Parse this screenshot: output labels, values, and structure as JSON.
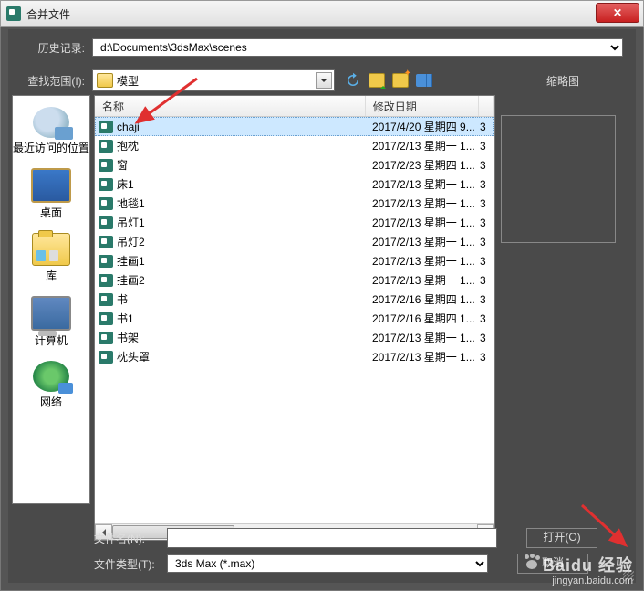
{
  "window": {
    "title": "合并文件"
  },
  "labels": {
    "history": "历史记录:",
    "scope": "查找范围(I):",
    "thumbnail": "缩略图",
    "filename": "文件名(N):",
    "filetype": "文件类型(T):"
  },
  "history_path": "d:\\Documents\\3dsMax\\scenes",
  "scope_folder": "模型",
  "columns": {
    "name": "名称",
    "date": "修改日期"
  },
  "files": [
    {
      "name": "chaji",
      "date": "2017/4/20 星期四 9...",
      "sel": true
    },
    {
      "name": "抱枕",
      "date": "2017/2/13 星期一 1..."
    },
    {
      "name": "窗",
      "date": "2017/2/23 星期四 1..."
    },
    {
      "name": "床1",
      "date": "2017/2/13 星期一 1..."
    },
    {
      "name": "地毯1",
      "date": "2017/2/13 星期一 1..."
    },
    {
      "name": "吊灯1",
      "date": "2017/2/13 星期一 1..."
    },
    {
      "name": "吊灯2",
      "date": "2017/2/13 星期一 1..."
    },
    {
      "name": "挂画1",
      "date": "2017/2/13 星期一 1..."
    },
    {
      "name": "挂画2",
      "date": "2017/2/13 星期一 1..."
    },
    {
      "name": "书",
      "date": "2017/2/16 星期四 1..."
    },
    {
      "name": "书1",
      "date": "2017/2/16 星期四 1..."
    },
    {
      "name": "书架",
      "date": "2017/2/13 星期一 1..."
    },
    {
      "name": "枕头罩",
      "date": "2017/2/13 星期一 1..."
    }
  ],
  "row_tail": "3",
  "sidebar": [
    {
      "label": "最近访问的位置",
      "icon": "ic-recent"
    },
    {
      "label": "桌面",
      "icon": "ic-desktop"
    },
    {
      "label": "库",
      "icon": "ic-lib"
    },
    {
      "label": "计算机",
      "icon": "ic-computer"
    },
    {
      "label": "网络",
      "icon": "ic-net"
    }
  ],
  "filename_value": "",
  "filetype_value": "3ds Max (*.max)",
  "buttons": {
    "open": "打开(O)",
    "cancel": "取消"
  },
  "watermark": {
    "brand": "Baidu 经验",
    "url": "jingyan.baidu.com"
  }
}
